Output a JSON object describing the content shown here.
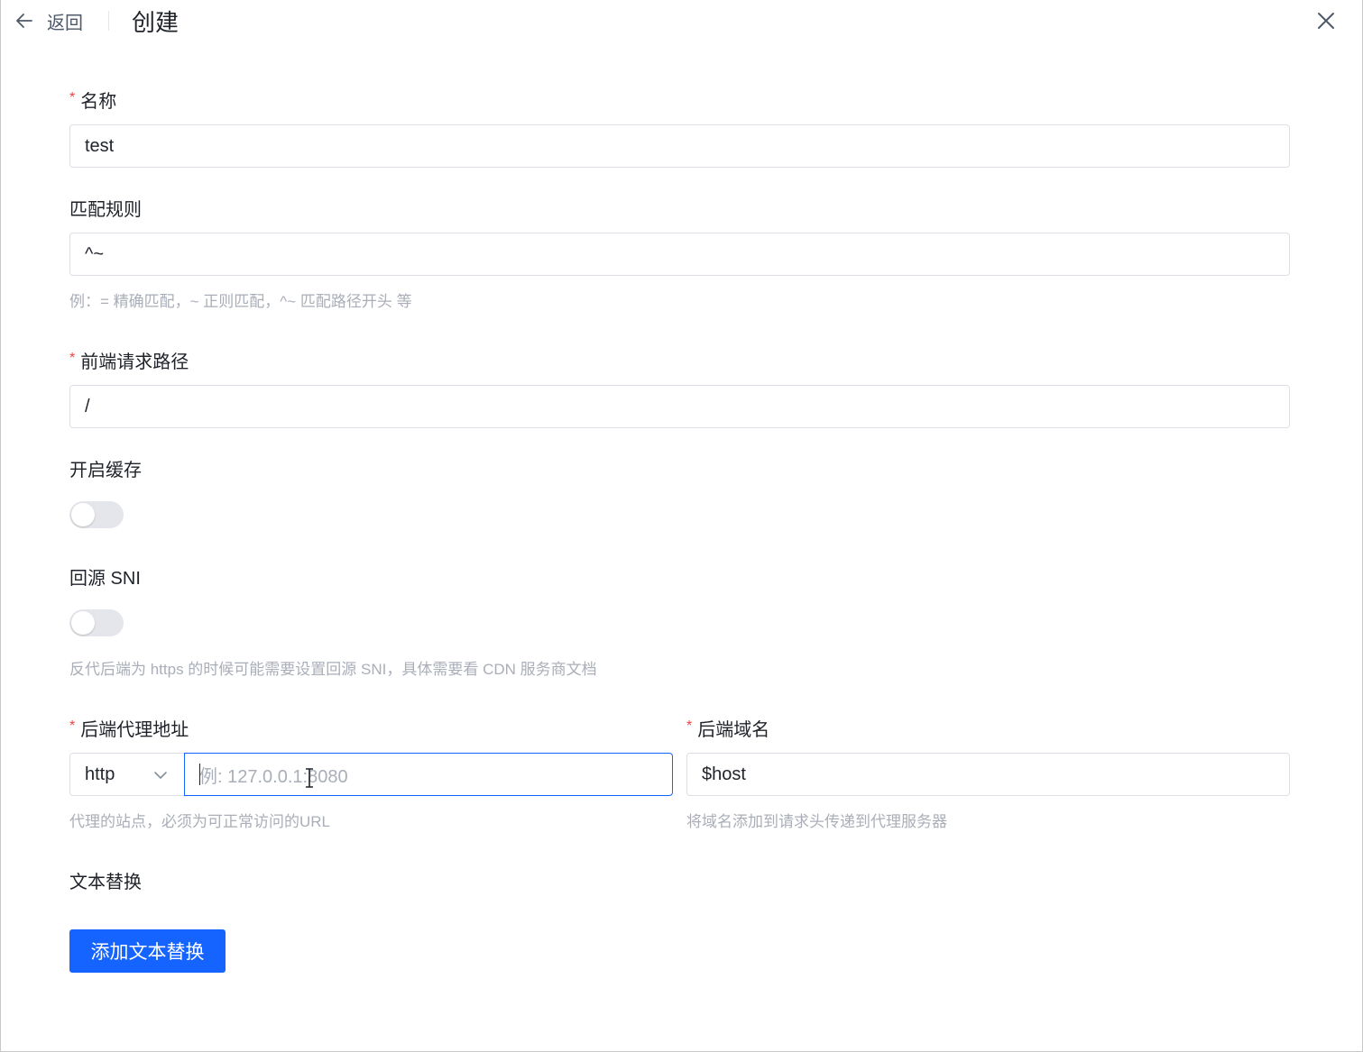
{
  "header": {
    "back_label": "返回",
    "title": "创建"
  },
  "form": {
    "name": {
      "label": "名称",
      "required_mark": "*",
      "value": "test"
    },
    "match_rule": {
      "label": "匹配规则",
      "value": "^~",
      "help": "例：= 精确匹配，~ 正则匹配，^~ 匹配路径开头 等"
    },
    "frontend_path": {
      "label": "前端请求路径",
      "required_mark": "*",
      "value": "/"
    },
    "cache": {
      "label": "开启缓存",
      "enabled": false
    },
    "sni": {
      "label": "回源 SNI",
      "enabled": false,
      "help": "反代后端为 https 的时候可能需要设置回源 SNI，具体需要看 CDN 服务商文档"
    },
    "backend_address": {
      "label": "后端代理地址",
      "required_mark": "*",
      "protocol": "http",
      "placeholder": "例: 127.0.0.1:8080",
      "help": "代理的站点，必须为可正常访问的URL"
    },
    "backend_host": {
      "label": "后端域名",
      "required_mark": "*",
      "value": "$host",
      "help": "将域名添加到请求头传递到代理服务器"
    },
    "text_replace": {
      "label": "文本替换",
      "add_button": "添加文本替换"
    }
  },
  "colors": {
    "primary": "#1664ff",
    "required": "#f53f3f",
    "help_text": "#a9aeb8"
  }
}
